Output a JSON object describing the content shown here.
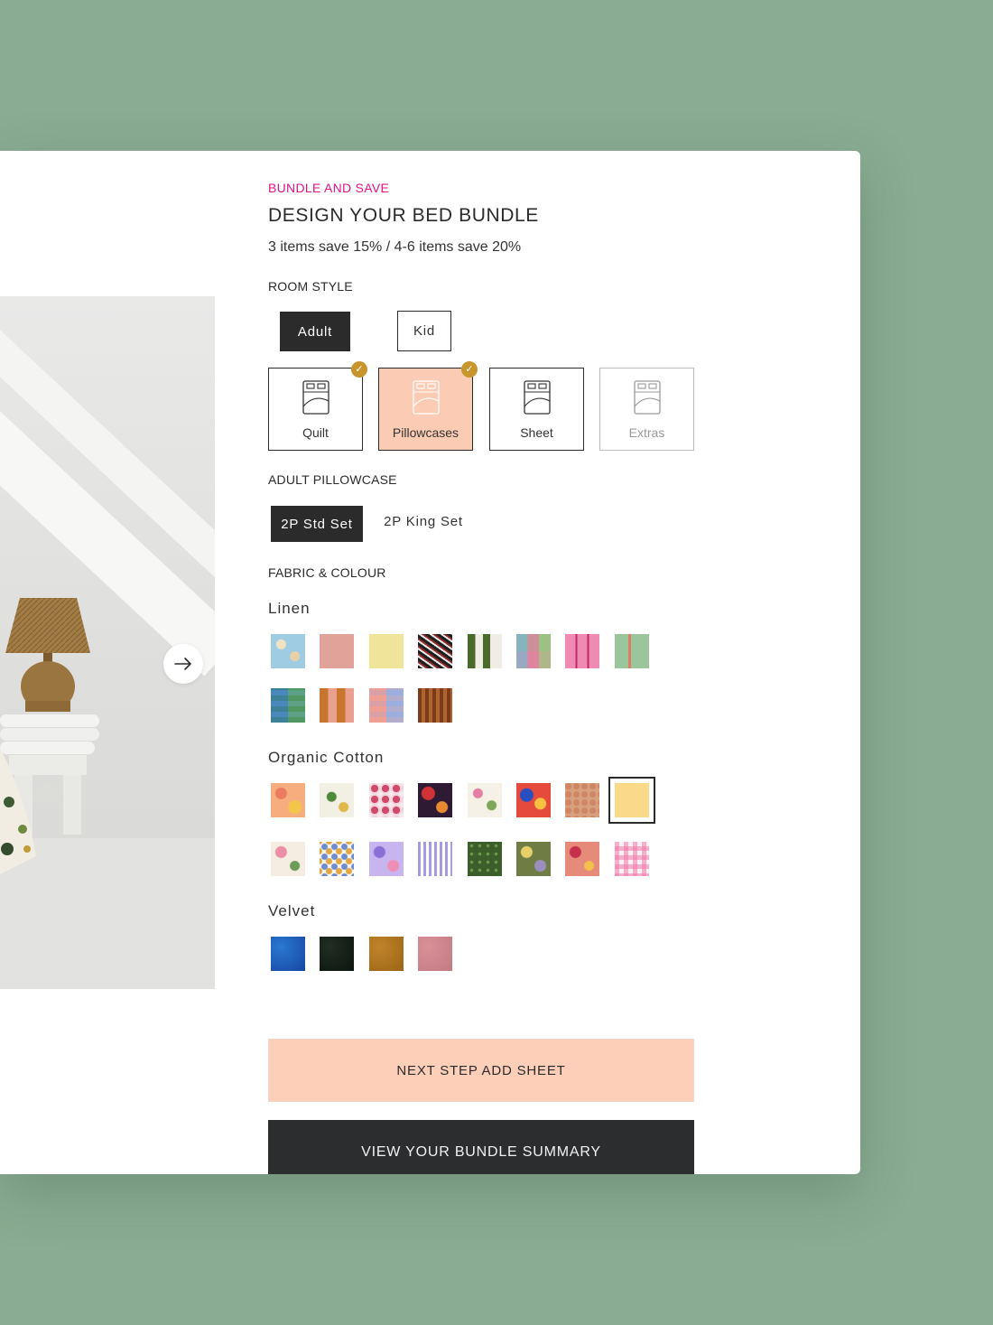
{
  "header": {
    "eyebrow": "BUNDLE AND SAVE",
    "title": "DESIGN YOUR BED BUNDLE",
    "subtitle": "3 items save 15% / 4-6 items save 20%"
  },
  "room_style": {
    "label": "ROOM STYLE",
    "options": [
      "Adult",
      "Kid"
    ],
    "selected": "Adult"
  },
  "products": [
    {
      "label": "Quilt",
      "icon": "bed-icon",
      "state": "checked"
    },
    {
      "label": "Pillowcases",
      "icon": "bed-icon",
      "state": "active-checked"
    },
    {
      "label": "Sheet",
      "icon": "bed-icon",
      "state": "default"
    },
    {
      "label": "Extras",
      "icon": "bed-icon",
      "state": "disabled"
    }
  ],
  "pillowcase": {
    "label": "ADULT PILLOWCASE",
    "options": [
      "2P Std Set",
      "2P King Set"
    ],
    "selected": "2P Std Set"
  },
  "fabric": {
    "label": "FABRIC & COLOUR",
    "groups": [
      {
        "name": "Linen",
        "swatch_count": 12
      },
      {
        "name": "Organic Cotton",
        "swatch_count": 16,
        "selected_index": 7
      },
      {
        "name": "Velvet",
        "swatch_count": 4
      }
    ]
  },
  "buttons": {
    "next_step": "NEXT STEP ADD SHEET",
    "summary": "VIEW YOUR BUNDLE SUMMARY"
  },
  "icons": {
    "carousel_next": "arrow-right-icon",
    "checked": "check-icon"
  },
  "colors": {
    "background": "#8aac92",
    "accent_pink": "#e0138c",
    "selected_product": "#fbcbb4",
    "check_badge": "#c8952d",
    "primary_dark": "#2c2d2f",
    "cta_peach": "#fdcfb8"
  }
}
